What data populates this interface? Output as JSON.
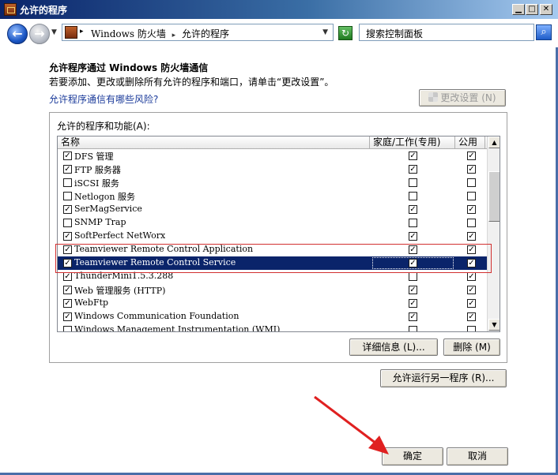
{
  "window": {
    "title": "允许的程序",
    "minimize": "▁",
    "maximize": "□",
    "close": "✕"
  },
  "address": {
    "crumb1": "Windows 防火墙",
    "crumb_sep": "▸",
    "crumb2": "允许的程序",
    "search_placeholder": "搜索控制面板"
  },
  "content": {
    "heading": "允许程序通过 Windows 防火墙通信",
    "subtext": "若要添加、更改或删除所有允许的程序和端口，请单击“更改设置”。",
    "risk_link": "允许程序通信有哪些风险?",
    "change_settings_label": "更改设置 (N)"
  },
  "list": {
    "group_label": "允许的程序和功能(A):",
    "col_name": "名称",
    "col_home": "家庭/工作(专用)",
    "col_public": "公用",
    "rows": [
      {
        "name": "DFS 管理",
        "enabled": true,
        "home": true,
        "public": true
      },
      {
        "name": "FTP 服务器",
        "enabled": true,
        "home": true,
        "public": true
      },
      {
        "name": "iSCSI 服务",
        "enabled": false,
        "home": false,
        "public": false
      },
      {
        "name": "Netlogon 服务",
        "enabled": false,
        "home": false,
        "public": false
      },
      {
        "name": "SerMagService",
        "enabled": true,
        "home": true,
        "public": true
      },
      {
        "name": "SNMP Trap",
        "enabled": false,
        "home": false,
        "public": false
      },
      {
        "name": "SoftPerfect NetWorx",
        "enabled": true,
        "home": true,
        "public": true
      },
      {
        "name": "Teamviewer Remote Control Application",
        "enabled": true,
        "home": true,
        "public": true
      },
      {
        "name": "Teamviewer Remote Control Service",
        "enabled": true,
        "home": true,
        "public": true,
        "selected": true
      },
      {
        "name": "ThunderMini1.5.3.288",
        "enabled": true,
        "home": false,
        "public": true
      },
      {
        "name": "Web 管理服务 (HTTP)",
        "enabled": true,
        "home": true,
        "public": true
      },
      {
        "name": "WebFtp",
        "enabled": true,
        "home": true,
        "public": true
      },
      {
        "name": "Windows Communication Foundation",
        "enabled": true,
        "home": true,
        "public": true
      },
      {
        "name": "Windows Management Instrumentation (WMI)",
        "enabled": false,
        "home": false,
        "public": false
      }
    ]
  },
  "buttons": {
    "details": "详细信息 (L)...",
    "delete": "删除 (M)",
    "allow_another": "允许运行另一程序 (R)...",
    "ok": "确定",
    "cancel": "取消"
  },
  "colors": {
    "selection": "#0a246a",
    "annotation_red": "#d23030"
  }
}
